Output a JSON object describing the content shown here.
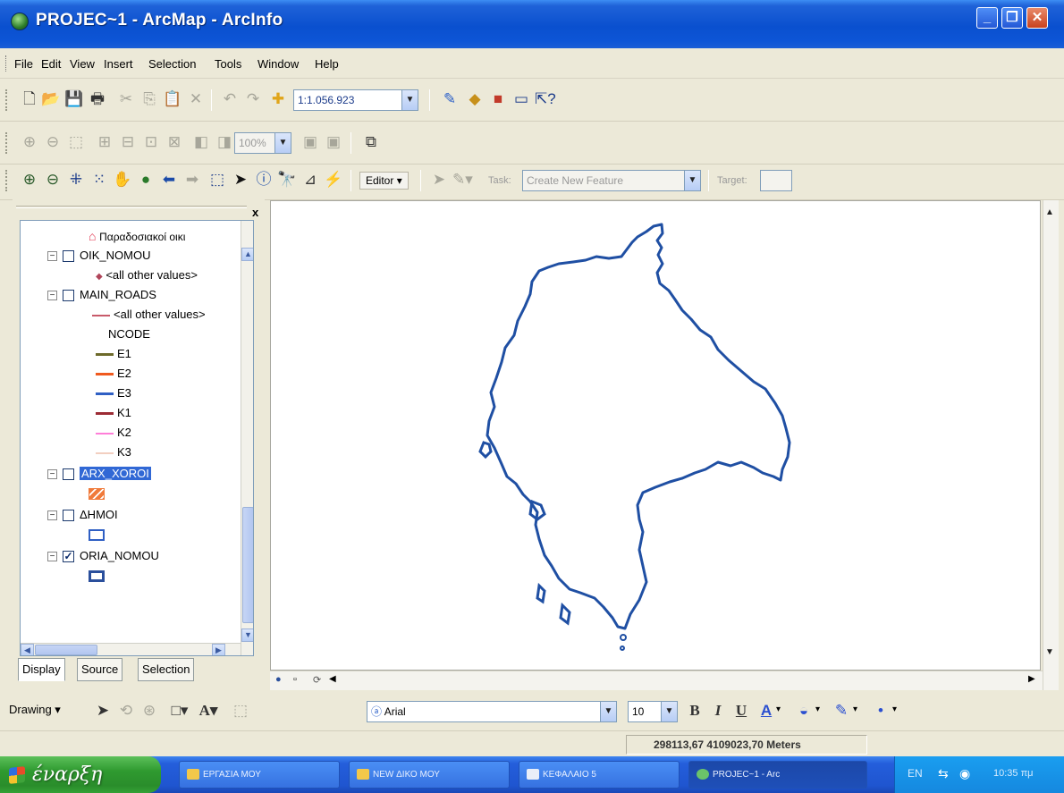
{
  "window": {
    "title": "PROJEC~1 - ArcMap - ArcInfo",
    "controls": {
      "minimize": "_",
      "maximize": "❐",
      "close": "✕"
    }
  },
  "menu": {
    "items": [
      {
        "label": "File"
      },
      {
        "label": "Edit"
      },
      {
        "label": "View"
      },
      {
        "label": "Insert"
      },
      {
        "label": "Selection"
      },
      {
        "label": "Tools"
      },
      {
        "label": "Window"
      },
      {
        "label": "Help"
      }
    ]
  },
  "standard_toolbar": {
    "scale": "1:1.056.923",
    "icons": [
      "new-icon",
      "open-icon",
      "save-icon",
      "print-icon",
      "cut-icon",
      "copy-icon",
      "paste-icon",
      "delete-icon",
      "undo-icon",
      "redo-icon",
      "add-data-icon",
      "editor-toolbar-icon",
      "arccatalog-icon",
      "arctoolbox-icon",
      "command-line-icon",
      "whats-this-icon"
    ]
  },
  "layout_toolbar": {
    "zoom_percent": "100%"
  },
  "tools_toolbar": {
    "editor_label": "Editor",
    "task_label": "Task:",
    "task_value": "Create New Feature",
    "target_label": "Target:"
  },
  "toc": {
    "layers": [
      {
        "kind": "symbol",
        "label": "Παραδοσιακοί οικι",
        "color": "#e0304a"
      },
      {
        "kind": "layer",
        "label": "OIK_NOMOU",
        "checked": false
      },
      {
        "kind": "symbol",
        "label": "<all other values>",
        "color": "#b0455a"
      },
      {
        "kind": "layer",
        "label": "MAIN_ROADS",
        "checked": false
      },
      {
        "kind": "line",
        "label": "<all other values>",
        "color": "#c85a6a"
      },
      {
        "kind": "heading",
        "label": "NCODE"
      },
      {
        "kind": "line",
        "label": "E1",
        "color": "#6d6a2a"
      },
      {
        "kind": "line",
        "label": "E2",
        "color": "#f05a1e"
      },
      {
        "kind": "line",
        "label": "E3",
        "color": "#2f5fc4"
      },
      {
        "kind": "line",
        "label": "K1",
        "color": "#9c2b34"
      },
      {
        "kind": "line",
        "label": "K2",
        "color": "#ff7ed8"
      },
      {
        "kind": "line",
        "label": "K3",
        "color": "#f2cfc0"
      },
      {
        "kind": "layer",
        "label": "ARX_XOROI",
        "checked": false,
        "selected": true
      },
      {
        "kind": "fill",
        "color": "#f07a3a"
      },
      {
        "kind": "layer",
        "label": "ΔΗΜΟΙ",
        "checked": false
      },
      {
        "kind": "fill-outline",
        "color": "#2f5fc4"
      },
      {
        "kind": "layer",
        "label": "ORIA_NOMOU",
        "checked": true
      },
      {
        "kind": "fill-outline",
        "color": "#2a4f9c"
      }
    ],
    "tabs": [
      "Display",
      "Source",
      "Selection"
    ],
    "close": "x"
  },
  "drawing_toolbar": {
    "drawing_label": "Drawing",
    "font": "Arial",
    "font_size": "10",
    "bold": "B",
    "italic": "I",
    "underline": "U",
    "font_color_label": "A"
  },
  "status": {
    "coords": "298113,67  4109023,70 Meters"
  },
  "taskbar": {
    "start_label": "έναρξη",
    "tasks": [
      {
        "label": "ΕΡΓΑΣΙΑ ΜΟΥ"
      },
      {
        "label": "NEW ΔΙΚΟ ΜΟΥ"
      },
      {
        "label": "ΚΕΦΑΛΑΙΟ 5"
      },
      {
        "label": "PROJEC~1 - Arc",
        "active": true
      }
    ],
    "clock": "10:35 πμ"
  },
  "colors": {
    "boundary_stroke": "#1f4fa3",
    "title_blue": "#0a50cf",
    "selection": "#3168d5"
  }
}
